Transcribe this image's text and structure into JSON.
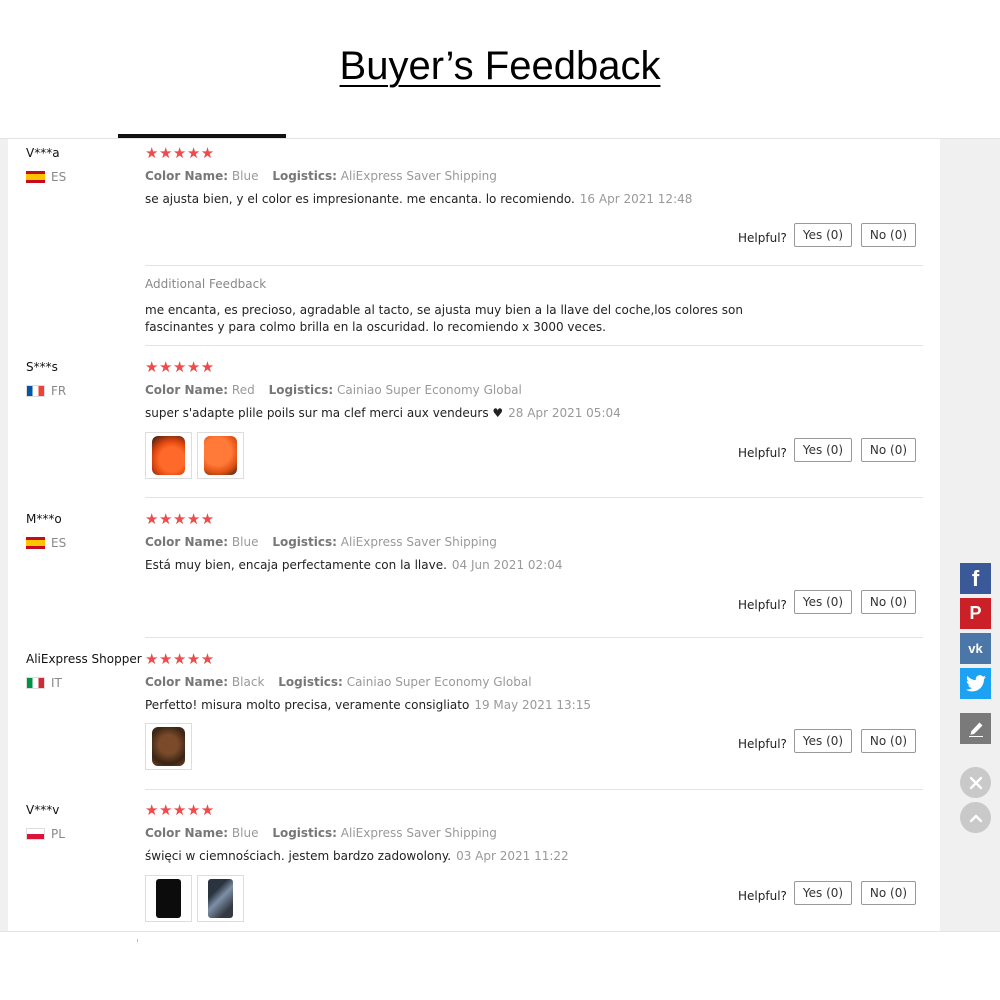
{
  "page": {
    "title": "Buyer’s Feedback"
  },
  "labels": {
    "color_name": "Color Name:",
    "logistics": "Logistics:",
    "helpful": "Helpful?",
    "additional_feedback": "Additional Feedback"
  },
  "reviews": [
    {
      "user": "V***a",
      "country": "ES",
      "stars": "★★★★★",
      "color": "Blue",
      "logistics": "AliExpress Saver Shipping",
      "text": "se ajusta bien, y el color es impresionante. me encanta. lo recomiendo.",
      "date": "16 Apr 2021 12:48",
      "yes": "Yes (0)",
      "no": "No (0)",
      "additional_feedback": "me encanta, es precioso, agradable al tacto, se ajusta muy bien a la llave del coche,los colores son fascinantes y para colmo brilla en la oscuridad. lo recomiendo x 3000 veces."
    },
    {
      "user": "S***s",
      "country": "FR",
      "stars": "★★★★★",
      "color": "Red",
      "logistics": "Cainiao Super Economy Global",
      "text": "super s'adapte plile poils sur ma clef merci aux vendeurs ♥",
      "date": "28 Apr 2021 05:04",
      "yes": "Yes (0)",
      "no": "No (0)"
    },
    {
      "user": "M***o",
      "country": "ES",
      "stars": "★★★★★",
      "color": "Blue",
      "logistics": "AliExpress Saver Shipping",
      "text": "Está muy bien, encaja perfectamente con la llave.",
      "date": "04 Jun 2021 02:04",
      "yes": "Yes (0)",
      "no": "No (0)"
    },
    {
      "user": "AliExpress Shopper",
      "country": "IT",
      "stars": "★★★★★",
      "color": "Black",
      "logistics": "Cainiao Super Economy Global",
      "text": "Perfetto! misura molto precisa, veramente consigliato",
      "date": "19 May 2021 13:15",
      "yes": "Yes (0)",
      "no": "No (0)"
    },
    {
      "user": "V***v",
      "country": "PL",
      "stars": "★★★★★",
      "color": "Blue",
      "logistics": "AliExpress Saver Shipping",
      "text": "święci w ciemnościach. jestem bardzo zadowolony.",
      "date": "03 Apr 2021 11:22",
      "yes": "Yes (0)",
      "no": "No (0)"
    }
  ],
  "social": {
    "facebook": "f",
    "pinterest": "P",
    "vk": "vk",
    "icons": [
      "facebook-icon",
      "pinterest-icon",
      "vk-icon",
      "twitter-icon",
      "edit-icon",
      "close-icon",
      "scroll-top-icon"
    ]
  },
  "colors": {
    "stars": "#f04b4b",
    "facebook": "#3b5998",
    "pinterest": "#cb2027",
    "vk": "#4a76a8",
    "twitter": "#1da1f2"
  }
}
